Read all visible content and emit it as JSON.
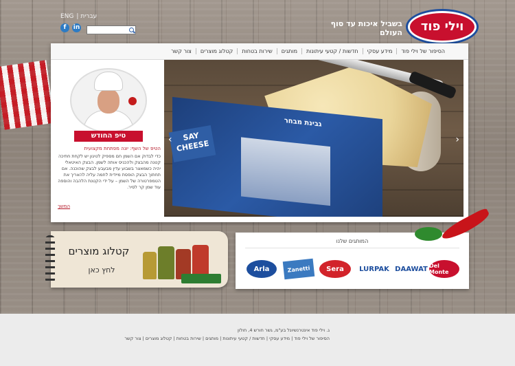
{
  "header": {
    "logo_text": "וילי פוד",
    "tagline": "בשביל איכות עד סוף העולם",
    "lang_en": "ENG",
    "lang_he": "עברית",
    "search_placeholder": "",
    "social": [
      "f",
      "in"
    ]
  },
  "nav": {
    "items": [
      "הסיפור של וילי פוד",
      "מידע עסקי",
      "חדשות / קטעי עיתונות",
      "מותגים",
      "שירות בטחות",
      "קטלוג מוצרים",
      "צור קשר"
    ]
  },
  "hero": {
    "badge_text": "SAY CHEESE",
    "package_label": "גבינת מבחר",
    "arrow_left": "‹",
    "arrow_right": "›"
  },
  "tip": {
    "banner": "טיפ החודש",
    "subtitle": "הטיפ של השף: יונה מפתחת מקצועית",
    "body": "כדי לבדוק אם השמן חם מספיק לטיגון יש לקחת חתיכה קטנה מהבצק ולהכניס אותה לשמן. הבצק האיטאלי יהיה כשמאצר בשבוע עדין מבעבע לבצק שהוכנה. אם תחתוך הבצק הופסת מיידית לחמה עליה להאריך את הטמפרטורה של השמן – על ידי הקטנת הלהבה והוספה עוד שמן קר לסיר.",
    "more": "המשך"
  },
  "catalog": {
    "title": "קטלוג מוצרים",
    "cta": "לחץ כאן"
  },
  "brands": {
    "heading": "המותגים שלנו",
    "items": [
      "Arla",
      "Zanetti",
      "Sera",
      "LURPAK",
      "DAAWAT",
      "Del Monte"
    ]
  },
  "colors": {
    "brand_red": "#c8102e",
    "brand_blue": "#1d4e9e"
  },
  "footer": {
    "address": "ג. וילי פוד אינטרנשיונל בע\"מ, גשר חורש 4, חולון",
    "links": "הסיפור של וילי פוד | מידע עסקי | חדשות / קטעי עיתונות | מותגים | שירות בטחות | קטלוג מוצרים | צור קשר"
  }
}
